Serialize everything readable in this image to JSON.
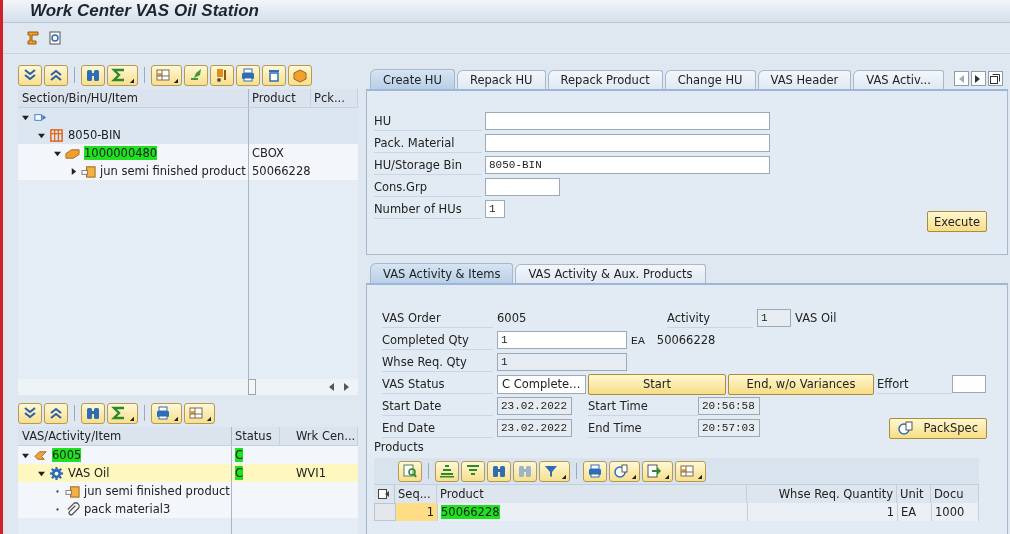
{
  "window": {
    "title": "Work Center VAS Oil Station"
  },
  "top_tree": {
    "columns": [
      "Section/Bin/HU/Item",
      "Product",
      "Pck..."
    ],
    "nodes": [
      {
        "kind": "root",
        "expandable": true,
        "expanded": true,
        "selected": false,
        "cells": [
          null,
          null
        ],
        "children": [
          {
            "kind": "bin",
            "label": "8050-BIN",
            "expandable": true,
            "expanded": true,
            "selected": false,
            "highlighted": false,
            "cells": [
              null,
              null
            ],
            "children": [
              {
                "kind": "hu",
                "label": "1000000480",
                "expandable": true,
                "expanded": true,
                "selected": false,
                "highlighted": true,
                "cells": [
                  {
                    "text": "CBOX",
                    "highlighted": false
                  },
                  null
                ],
                "children": [
                  {
                    "kind": "product",
                    "label": "jun semi finished product",
                    "expandable": true,
                    "expanded": false,
                    "selected": false,
                    "highlighted": false,
                    "cells": [
                      {
                        "text": "50066228",
                        "highlighted": false
                      },
                      null
                    ]
                  }
                ]
              }
            ]
          }
        ]
      }
    ]
  },
  "bottom_tree": {
    "columns": [
      "VAS/Activity/Item",
      "Status",
      "Wrk Cen..."
    ],
    "nodes": [
      {
        "kind": "order",
        "label": "6005",
        "expandable": true,
        "expanded": true,
        "selected": false,
        "highlighted": true,
        "cells": [
          {
            "text": "C",
            "highlighted": true
          },
          null
        ],
        "children": [
          {
            "kind": "activity",
            "label": "VAS Oil",
            "expandable": true,
            "expanded": true,
            "selected": true,
            "highlighted": false,
            "cells": [
              {
                "text": "C",
                "highlighted": true
              },
              {
                "text": "WVI1",
                "highlighted": false
              }
            ],
            "children": [
              {
                "kind": "product",
                "label": "jun semi finished product",
                "expandable": false,
                "expanded": false,
                "selected": false,
                "highlighted": false,
                "cells": [
                  null,
                  null
                ]
              },
              {
                "kind": "material",
                "label": "pack material3",
                "expandable": false,
                "expanded": false,
                "selected": false,
                "highlighted": false,
                "cells": [
                  null,
                  null
                ]
              }
            ]
          }
        ]
      }
    ]
  },
  "hu_tabs": [
    {
      "label": "Create HU",
      "selected": true
    },
    {
      "label": "Repack HU",
      "selected": false
    },
    {
      "label": "Repack Product",
      "selected": false
    },
    {
      "label": "Change HU",
      "selected": false
    },
    {
      "label": "VAS Header",
      "selected": false
    },
    {
      "label": "VAS Activ...",
      "selected": false
    }
  ],
  "hu_form": {
    "fields": [
      {
        "label": "HU"
      },
      {
        "label": "Pack. Material"
      },
      {
        "label": "HU/Storage Bin",
        "value": "8050-BIN"
      },
      {
        "label": "Cons.Grp"
      },
      {
        "label": "Number of HUs",
        "value": "1"
      }
    ],
    "execute_button": "Execute"
  },
  "vas_tabs": [
    {
      "label": "VAS Activity & Items",
      "selected": true
    },
    {
      "label": "VAS Activity & Aux. Products",
      "selected": false
    }
  ],
  "vas_form": {
    "vas_order": {
      "label": "VAS Order",
      "value": "6005"
    },
    "activity": {
      "label": "Activity",
      "value": "1",
      "description": "VAS Oil",
      "disabled": true
    },
    "completed_qty": {
      "label": "Completed Qty",
      "value": "1",
      "unit": "EA",
      "product": "50066228",
      "disabled": false
    },
    "whse_req_qty": {
      "label": "Whse Req. Qty",
      "value": "1",
      "disabled": true
    },
    "vas_status": {
      "label": "VAS Status",
      "value": "C Complete…"
    },
    "start_button": "Start",
    "end_button": "End, w/o Variances",
    "effort": {
      "label": "Effort",
      "disabled": false
    },
    "start_date": {
      "label": "Start Date",
      "value": "23.02.2022",
      "disabled": true
    },
    "start_time": {
      "label": "Start Time",
      "value": "20:56:58",
      "disabled": true
    },
    "end_date": {
      "label": "End Date",
      "value": "23.02.2022",
      "disabled": true
    },
    "end_time": {
      "label": "End Time",
      "value": "20:57:03",
      "disabled": true
    },
    "packspec_button": "PackSpec"
  },
  "products": {
    "title": "Products",
    "columns": [
      "Seq...",
      "Product",
      "Whse Req. Quantity",
      "Unit",
      "Docu"
    ],
    "rows": [
      {
        "seq": "1",
        "product": "50066228",
        "product_highlighted": true,
        "quantity": "1",
        "unit": "EA",
        "document": "1000"
      }
    ]
  }
}
